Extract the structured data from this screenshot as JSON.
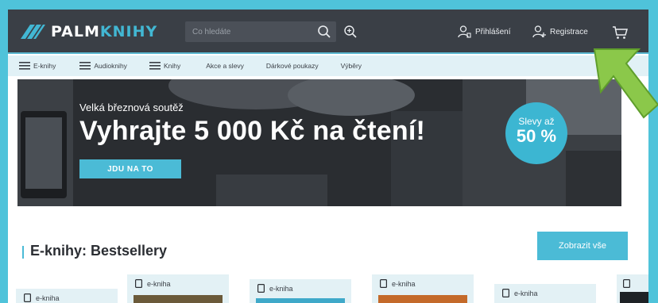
{
  "header": {
    "logo": {
      "part1": "PALM",
      "part2": "KNIHY"
    },
    "search": {
      "placeholder": "Co hledáte",
      "value": ""
    },
    "login_label": "Přihlášení",
    "register_label": "Registrace",
    "icons": [
      "search-icon",
      "zoom-in-icon",
      "user-icon",
      "user-add-icon",
      "cart-icon"
    ]
  },
  "categories": [
    {
      "label": "E-knihy",
      "menu": true
    },
    {
      "label": "Audioknihy",
      "menu": true
    },
    {
      "label": "Knihy",
      "menu": true
    },
    {
      "label": "Akce a slevy",
      "menu": false
    },
    {
      "label": "Dárkové poukazy",
      "menu": false
    },
    {
      "label": "Výběry",
      "menu": false
    }
  ],
  "hero": {
    "kicker": "Velká březnová soutěž",
    "headline": "Vyhrajte 5 000 Kč na čtení!",
    "cta_label": "JDU NA TO",
    "badge": {
      "line1": "Slevy až",
      "line2": "50 %"
    }
  },
  "section": {
    "title": "E-knihy: Bestsellery",
    "show_all_label": "Zobrazit vše"
  },
  "products": [
    {
      "type_label": "e-kniha"
    },
    {
      "type_label": "e-kniha"
    },
    {
      "type_label": "e-kniha"
    },
    {
      "type_label": "e-kniha"
    },
    {
      "type_label": "e-kniha"
    }
  ],
  "colors": {
    "frame": "#4fc3da",
    "topbar": "#3a3f46",
    "accent": "#4bbbd6",
    "catbar": "#e1f1f6",
    "arrow": "#8bc84a"
  }
}
